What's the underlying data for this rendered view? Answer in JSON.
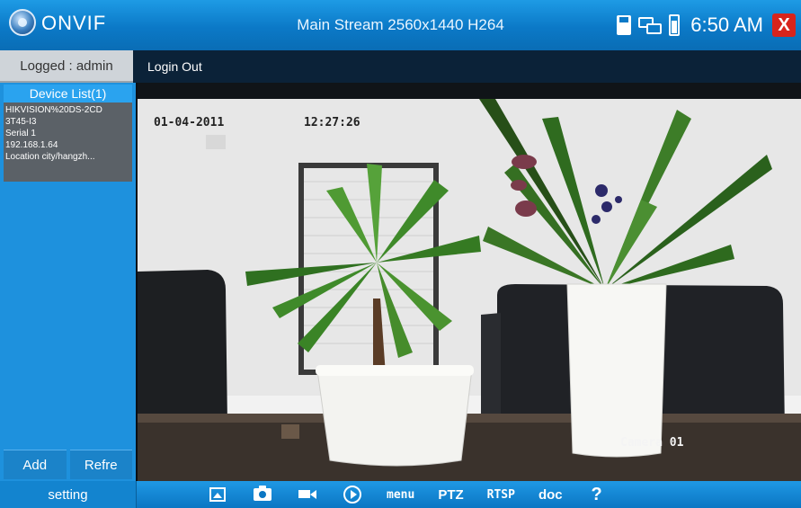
{
  "header": {
    "app_title": "ONVIF",
    "stream_info": "Main Stream 2560x1440 H264",
    "time": "6:50 AM",
    "close_symbol": "X"
  },
  "login": {
    "logged_text": "Logged : admin",
    "login_out_label": "Login Out"
  },
  "sidebar": {
    "device_list_title": "Device List(1)",
    "device": {
      "name_line1": "HIKVISION%20DS-2CD",
      "name_line2": "3T45-I3",
      "serial": "Serial 1",
      "ip": "192.168.1.64",
      "location": "Location city/hangzh..."
    },
    "add_label": "Add",
    "refresh_label": "Refre",
    "setting_label": "setting"
  },
  "video": {
    "osd_date": "01-04-2011",
    "osd_time": "12:27:26",
    "camera_label": "Camera 01"
  },
  "toolbar": {
    "icons": [
      "gallery-icon",
      "camera-icon",
      "video-record-icon",
      "play-icon"
    ],
    "menu_label": "menu",
    "ptz_label": "PTZ",
    "rtsp_label": "RTSP",
    "doc_label": "doc",
    "help_label": "?"
  },
  "colors": {
    "title_bar": "#0b79c7",
    "sidebar": "#1e91dd",
    "close_button": "#d8241c",
    "toolbar": "#0b76c3"
  }
}
